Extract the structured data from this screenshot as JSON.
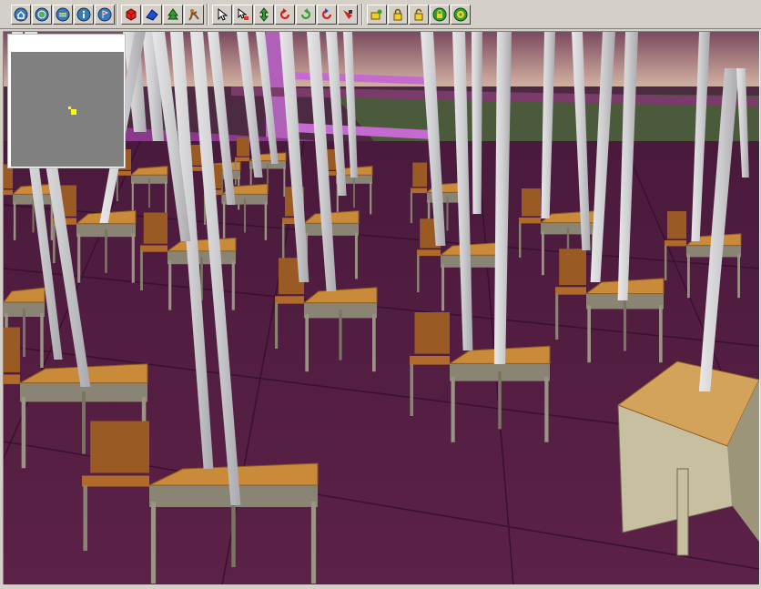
{
  "toolbar": {
    "groups": [
      {
        "name": "navigation",
        "buttons": [
          {
            "icon": "home-icon"
          },
          {
            "icon": "globe-icon"
          },
          {
            "icon": "layers-icon"
          },
          {
            "icon": "info-icon"
          },
          {
            "icon": "flag-icon"
          }
        ]
      },
      {
        "name": "objects",
        "buttons": [
          {
            "icon": "red-cube-icon"
          },
          {
            "icon": "blue-shape-icon"
          },
          {
            "icon": "green-tree-icon"
          },
          {
            "icon": "figure-icon"
          }
        ]
      },
      {
        "name": "tools",
        "buttons": [
          {
            "icon": "pointer-arrow-icon"
          },
          {
            "icon": "select-move-icon"
          },
          {
            "icon": "move-vertical-icon"
          },
          {
            "icon": "rotate-left-icon"
          },
          {
            "icon": "rotate-right-icon"
          },
          {
            "icon": "rotate-reset-icon"
          },
          {
            "icon": "delete-icon"
          }
        ]
      },
      {
        "name": "view",
        "buttons": [
          {
            "icon": "camera-user-icon"
          },
          {
            "icon": "lock-icon"
          },
          {
            "icon": "lock-open-icon"
          },
          {
            "icon": "lock-circle-icon"
          },
          {
            "icon": "lock-circle-green-icon"
          }
        ]
      }
    ]
  },
  "colors": {
    "toolbar_bg": "#d4d0c8",
    "floor": "#5a1f45",
    "desk_top": "#c98a3a",
    "desk_frame": "#a8a090",
    "pole": "#c9c9cc",
    "minimap_bg": "#808080",
    "minimap_marker": "#ffff00"
  }
}
